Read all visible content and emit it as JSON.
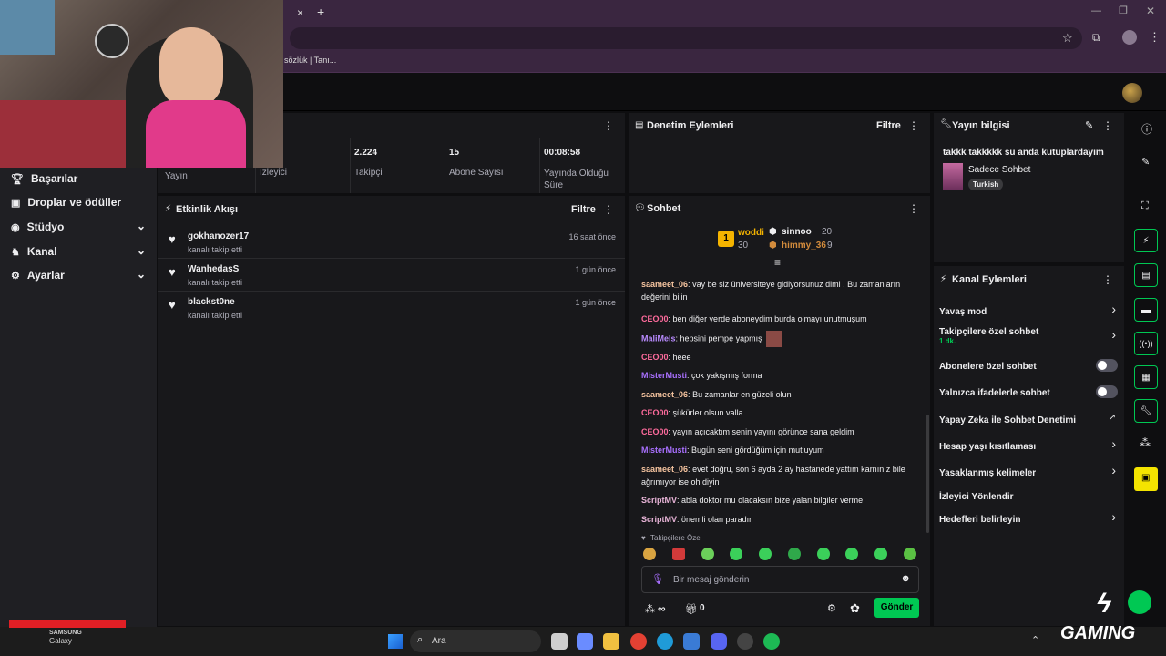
{
  "browser": {
    "tab_close": "×",
    "new_tab": "+",
    "bookmark_text": "sözlük | Tanı..."
  },
  "stats": [
    {
      "value": "",
      "label": "Yayın"
    },
    {
      "value": "",
      "label": "İzleyici"
    },
    {
      "value": "2.224",
      "label": "Takipçi"
    },
    {
      "value": "15",
      "label": "Abone Sayısı"
    },
    {
      "value": "00:08:58",
      "label": "Yayında Olduğu Süre"
    }
  ],
  "sidebar": {
    "items": [
      {
        "label": "Başarılar"
      },
      {
        "label": "Droplar ve ödüller"
      },
      {
        "label": "Stüdyo"
      },
      {
        "label": "Kanal"
      },
      {
        "label": "Ayarlar"
      }
    ]
  },
  "activity": {
    "title": "Etkinlik Akışı",
    "filter": "Filtre",
    "events": [
      {
        "user": "gokhanozer17",
        "action": "kanalı takip etti",
        "time": "16 saat önce"
      },
      {
        "user": "WanhedasS",
        "action": "kanalı takip etti",
        "time": "1 gün önce"
      },
      {
        "user": "blackst0ne",
        "action": "kanalı takip etti",
        "time": "1 gün önce"
      }
    ]
  },
  "moderation": {
    "title": "Denetim Eylemleri",
    "filter": "Filtre"
  },
  "chat": {
    "title": "Sohbet",
    "leaderboard": {
      "rank": "1",
      "first": {
        "name": "woddi",
        "score": "30"
      },
      "second": {
        "name": "sinnoo",
        "score": "20"
      },
      "third": {
        "name": "himmy_36",
        "score": "9"
      }
    },
    "messages": [
      {
        "user": "saameet_06",
        "text": "vay be siz üniversiteye gidiyorsunuz dimi . Bu zamanların değerini bilin",
        "cls": "sa"
      },
      {
        "user": "CEO00",
        "text": "ben diğer yerde aboneydim burda olmayı unutmuşum",
        "cls": "ce"
      },
      {
        "user": "MaliMels",
        "text": "hepsini pempe yapmış",
        "cls": "ma"
      },
      {
        "user": "CEO00",
        "text": "heee",
        "cls": "ce"
      },
      {
        "user": "MisterMusti",
        "text": "çok yakışmış forma",
        "cls": "mi"
      },
      {
        "user": "saameet_06",
        "text": "Bu zamanlar en güzeli olun",
        "cls": "sa"
      },
      {
        "user": "CEO00",
        "text": "şükürler olsun valla",
        "cls": "ce"
      },
      {
        "user": "CEO00",
        "text": "yayın açıcaktım senin yayını görünce sana geldim",
        "cls": "ce"
      },
      {
        "user": "MisterMusti",
        "text": "Bugün seni gördüğüm için mutluyum",
        "cls": "mi"
      },
      {
        "user": "saameet_06",
        "text": "evet doğru, son 6 ayda 2 ay hastanede yattım karnınız bile ağrımıyor ise oh diyin",
        "cls": "sa"
      },
      {
        "user": "ScriptMV",
        "text": "abla doktor mu olacaksın bize yalan bilgiler verme",
        "cls": "sc"
      },
      {
        "user": "ScriptMV",
        "text": "önemli olan paradır",
        "cls": "sc"
      }
    ],
    "emote_header": "Takipçilere Özel",
    "input_placeholder": "Bir mesaj gönderin",
    "points": "∞",
    "gift_count": "0",
    "send": "Gönder"
  },
  "stream_info": {
    "title": "Yayın bilgisi",
    "stream_title": "takkk takkkkk su anda kutuplardayım",
    "category": "Sadece Sohbet",
    "tag": "Turkish"
  },
  "channel_actions": {
    "title": "Kanal Eylemleri",
    "items": [
      {
        "label": "Yavaş mod"
      },
      {
        "label": "Takipçilere özel sohbet",
        "sub": "1 dk."
      },
      {
        "label": "Abonelere özel sohbet"
      },
      {
        "label": "Yalnızca ifadelerle sohbet"
      },
      {
        "label": "Yapay Zeka ile Sohbet Denetimi"
      },
      {
        "label": "Hesap yaşı kısıtlaması"
      },
      {
        "label": "Yasaklanmış kelimeler"
      },
      {
        "label": "İzleyici Yönlendir"
      },
      {
        "label": "Hedefleri belirleyin"
      }
    ]
  },
  "taskbar": {
    "search": "Ara",
    "phone_brand": "SAMSUNG",
    "phone_model": "Galaxy"
  },
  "watermark": {
    "brand": "GAMING"
  },
  "colors": {
    "accent_green": "#00c853",
    "twitch_purple": "#a970ff",
    "panel_bg": "#18181b"
  }
}
